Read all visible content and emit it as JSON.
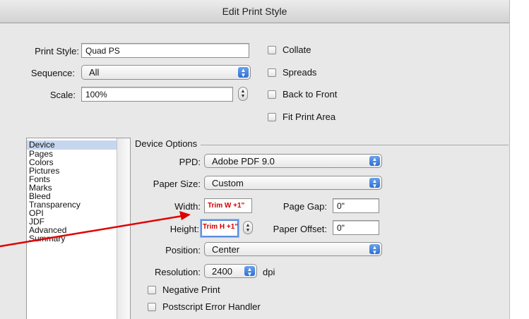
{
  "window": {
    "title": "Edit Print Style"
  },
  "top": {
    "print_style_label": "Print Style:",
    "print_style_value": "Quad PS",
    "sequence_label": "Sequence:",
    "sequence_value": "All",
    "scale_label": "Scale:",
    "scale_value": "100%",
    "options": [
      {
        "label": "Collate"
      },
      {
        "label": "Spreads"
      },
      {
        "label": "Back to Front"
      },
      {
        "label": "Fit Print Area"
      }
    ]
  },
  "sidebar": {
    "items": [
      "Device",
      "Pages",
      "Colors",
      "Pictures",
      "Fonts",
      "Marks",
      "Bleed",
      "Transparency",
      "OPI",
      "JDF",
      "Advanced",
      "Summary"
    ],
    "selected": "Device"
  },
  "device": {
    "group_label": "Device Options",
    "ppd_label": "PPD:",
    "ppd_value": "Adobe PDF 9.0",
    "paper_size_label": "Paper Size:",
    "paper_size_value": "Custom",
    "width_label": "Width:",
    "width_value": "Trim W +1\"",
    "height_label": "Height:",
    "height_value": "Trim H +1\"",
    "page_gap_label": "Page Gap:",
    "page_gap_value": "0\"",
    "paper_offset_label": "Paper Offset:",
    "paper_offset_value": "0\"",
    "position_label": "Position:",
    "position_value": "Center",
    "resolution_label": "Resolution:",
    "resolution_value": "2400",
    "resolution_unit": "dpi",
    "negative_print_label": "Negative Print",
    "postscript_error_label": "Postscript Error Handler"
  },
  "annotation": {
    "arrow_color": "#e00000"
  }
}
